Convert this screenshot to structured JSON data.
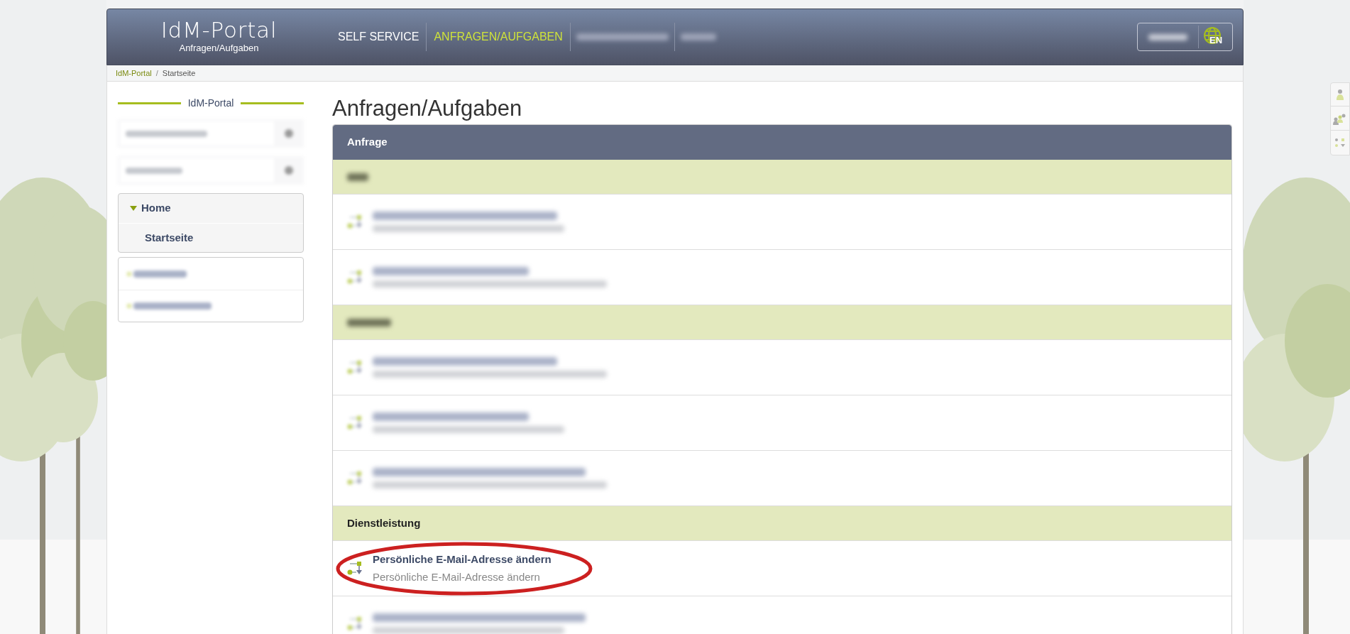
{
  "header": {
    "logo": "IdM-Portal",
    "subtitle": "Anfragen/Aufgaben",
    "nav": [
      {
        "label": "SELF SERVICE",
        "selected": false,
        "redacted": false
      },
      {
        "label": "ANFRAGEN/AUFGABEN",
        "selected": true,
        "redacted": false
      },
      {
        "redacted": true,
        "selected": false
      },
      {
        "redacted": true,
        "selected": false
      }
    ],
    "language": "EN"
  },
  "breadcrumb": [
    {
      "label": "IdM-Portal",
      "kind": "link"
    },
    {
      "label": "/",
      "kind": "separator"
    },
    {
      "label": "Startseite",
      "kind": "current"
    }
  ],
  "sidebar": {
    "title": "IdM-Portal",
    "menu": {
      "label": "Home",
      "expanded": true,
      "children": [
        {
          "label": "Startseite"
        }
      ]
    }
  },
  "page_title": "Anfragen/Aufgaben",
  "table": {
    "header": "Anfrage",
    "rows": [
      {
        "kind": "group",
        "redacted": true
      },
      {
        "kind": "item",
        "redacted": true
      },
      {
        "kind": "item",
        "redacted": true
      },
      {
        "kind": "group",
        "redacted": true
      },
      {
        "kind": "item",
        "redacted": true
      },
      {
        "kind": "item",
        "redacted": true
      },
      {
        "kind": "item",
        "redacted": true
      },
      {
        "kind": "group",
        "redacted": false,
        "title": "Dienstleistung"
      },
      {
        "kind": "item",
        "redacted": false,
        "title": "Persönliche E-Mail-Adresse ändern",
        "subtitle": "Persönliche E-Mail-Adresse ändern",
        "highlighted": true
      },
      {
        "kind": "item",
        "redacted": true
      }
    ]
  }
}
